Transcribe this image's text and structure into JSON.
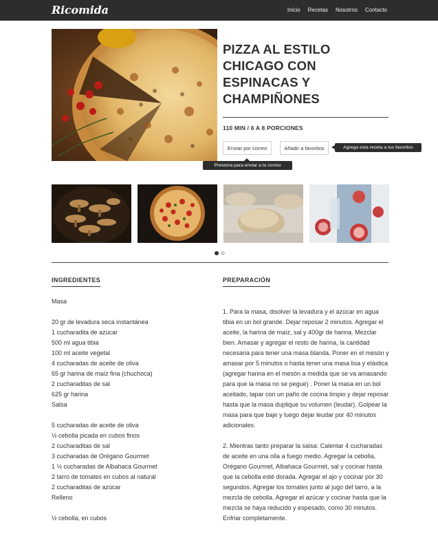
{
  "nav": {
    "logo": "Ricomida",
    "links": [
      "Inicio",
      "Recetas",
      "Nosotros",
      "Contacto"
    ]
  },
  "recipe": {
    "title": "Pizza al estilo Chicago con espinacas y champiñones",
    "meta": "110 MIN / 6 A 8 PORCIONES",
    "email_button": "Enviar por correo",
    "fav_button": "Añadir a favoritos",
    "email_tooltip": "Presiona para enviar a tu correo",
    "fav_tooltip": "Agrega esta receta a tus favoritos"
  },
  "gallery": {
    "thumbnails": [
      "mushrooms-photo",
      "pizza-photo",
      "dough-photo",
      "tomatoes-photo"
    ],
    "dots": 2,
    "active_dot": 0
  },
  "ingredients": {
    "heading": "INGREDIENTES",
    "items": [
      "Masa",
      "",
      "20 gr de levadura seca instantánea",
      "1 cucharadita de azúcar",
      "500 ml agua tibia",
      "100 ml aceite vegetal",
      "4 cucharadas de aceite de oliva",
      "65 gr harina de maíz fina (chuchoca)",
      "2 cucharaditas de sal",
      "625 gr harina",
      "Salsa",
      "",
      "5 cucharadas de aceite de oliva",
      "½  cebolla picada en cubos finos",
      "2 cucharaditas de sal",
      "3  cucharadas de Orégano Gourmet",
      "1 ½ cucharadas de Albahaca Gourmet",
      "2 tarro de tomates en cubos al natural",
      "2 cucharaditas de azúcar",
      "Relleno",
      "",
      "½  cebolla, en cubos"
    ]
  },
  "preparation": {
    "heading": "PREPARACIÓN",
    "paragraphs": [
      "1. Para la masa, disolver la levadura y el azúcar en agua tibia en un bol grande.  Dejar reposar 2 minutos.  Agregar el aceite, la harina de maíz, sal y 400gr de harina.  Mezclar bien.  Amasar y agregar el resto de harina, la cantidad necesaria para tener una masa blanda. Poner en el mesón y amasar por 5 minutos o hasta tener una masa lisa y elástica (agregar harina en el mesón a medida que se va amasando para que la masa no se pegue) . Poner la masa en un bol aceitado, tapar con un paño de cocina limpio y dejar reposar hasta que la masa duplique su volumen (leudar).  Golpear la masa para que baje y luego dejar leudar por 40 minutos adicionales.",
      "2. Mientras tanto preparar la salsa: Calentar 4 cucharadas de aceite en una olla a fuego medio.  Agregar la cebolla, Orégano Gourmet, Albahaca Gourmet, sal y cocinar hasta que la cebolla esté dorada. Agregar el ajo y cocinar por 30 segundos.  Agregar los tomates junto al jugo del tarro, a la mezcla de cebolla. Agregar el azúcar  y cocinar hasta que la mezcla se haya reducido y espesado, como 30 minutos. Enfriar completamente."
    ]
  }
}
